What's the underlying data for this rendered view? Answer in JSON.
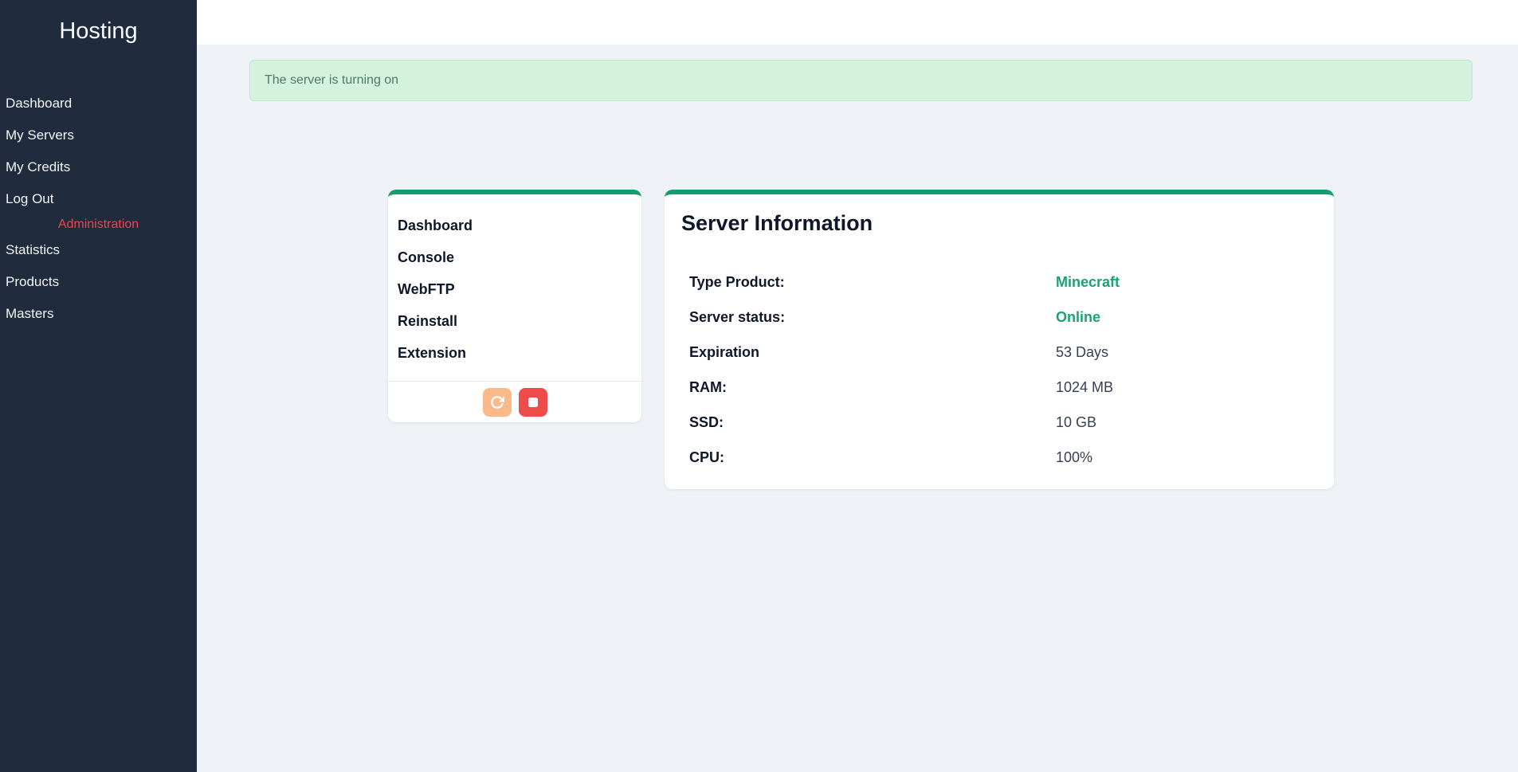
{
  "sidebar": {
    "title": "Hosting",
    "items": [
      {
        "label": "Dashboard"
      },
      {
        "label": "My Servers"
      },
      {
        "label": "My Credits"
      },
      {
        "label": "Log Out"
      }
    ],
    "admin_section_label": "Administration",
    "admin_items": [
      {
        "label": "Statistics"
      },
      {
        "label": "Products"
      },
      {
        "label": "Masters"
      }
    ]
  },
  "alert": {
    "message": "The server is turning on"
  },
  "server_nav": {
    "items": [
      {
        "label": "Dashboard"
      },
      {
        "label": "Console"
      },
      {
        "label": "WebFTP"
      },
      {
        "label": "Reinstall"
      },
      {
        "label": "Extension"
      }
    ]
  },
  "controls": {
    "restart_icon": "refresh-icon",
    "stop_icon": "stop-icon"
  },
  "server_info": {
    "title": "Server Information",
    "rows": [
      {
        "label": "Type Product:",
        "value": "Minecraft",
        "highlight": true
      },
      {
        "label": "Server status:",
        "value": "Online",
        "highlight": true
      },
      {
        "label": "Expiration",
        "value": "53 Days",
        "highlight": false
      },
      {
        "label": "RAM:",
        "value": "1024 MB",
        "highlight": false
      },
      {
        "label": "SSD:",
        "value": "10 GB",
        "highlight": false
      },
      {
        "label": "CPU:",
        "value": "100%",
        "highlight": false
      }
    ]
  },
  "colors": {
    "accent_green": "#169d6f",
    "value_green": "#17a374",
    "sidebar_bg": "#202b3d",
    "admin_red": "#e8484f",
    "restart_orange": "#f9b98b",
    "stop_red": "#ee4b4b",
    "alert_bg": "#d3f3de",
    "alert_border": "#bce8cb",
    "alert_text": "#517868",
    "page_bg": "#eef2f7"
  }
}
